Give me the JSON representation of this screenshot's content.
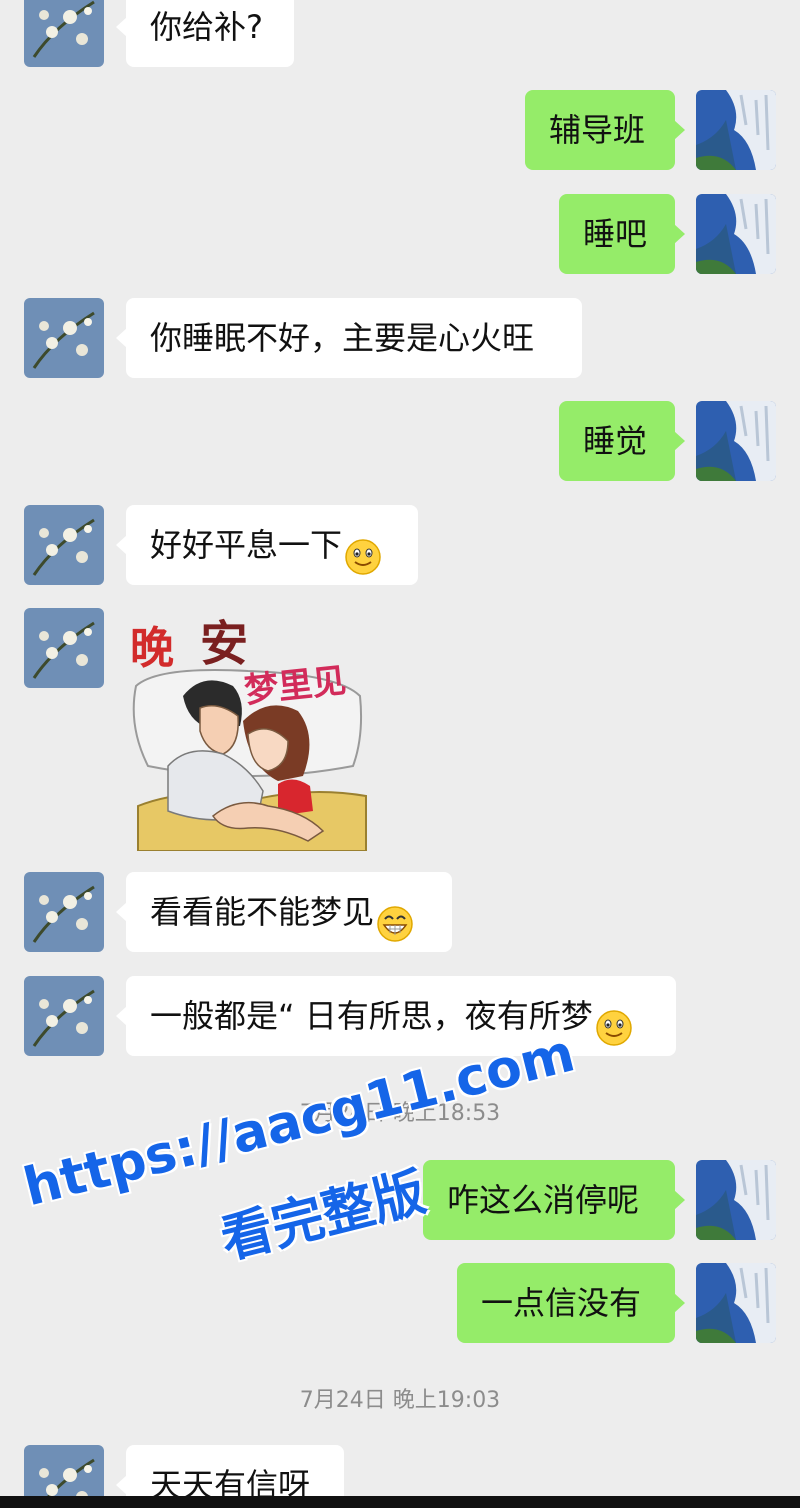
{
  "messages": [
    {
      "side": "left",
      "text": "你给补?"
    },
    {
      "side": "right",
      "text": "辅导班"
    },
    {
      "side": "right",
      "text": "睡吧"
    },
    {
      "side": "left",
      "text": "你睡眠不好，主要是心火旺"
    },
    {
      "side": "right",
      "text": "睡觉"
    },
    {
      "side": "left",
      "text": "好好平息一下",
      "emoji": "smile-emoji"
    },
    {
      "side": "left",
      "sticker": {
        "title_1": "晚",
        "title_2": "安",
        "subtitle": "梦里见"
      }
    },
    {
      "side": "left",
      "text": "看看能不能梦见",
      "emoji": "grin-emoji"
    },
    {
      "side": "left",
      "text": "一般都是“ 日有所思，夜有所梦",
      "emoji": "smile-emoji"
    },
    {
      "side": "right",
      "text": "咋这么消停呢"
    },
    {
      "side": "right",
      "text": "一点信没有"
    },
    {
      "side": "left",
      "text": "天天有信呀"
    }
  ],
  "timestamps": [
    "7月24日 晚上18:53",
    "7月24日 晚上19:03"
  ],
  "watermark": {
    "line1": "https://aacg11.com",
    "line2": "看完整版"
  },
  "colors": {
    "background": "#ededed",
    "bubble_self": "#95ec69",
    "bubble_other": "#ffffff",
    "watermark": "#1565e8"
  }
}
